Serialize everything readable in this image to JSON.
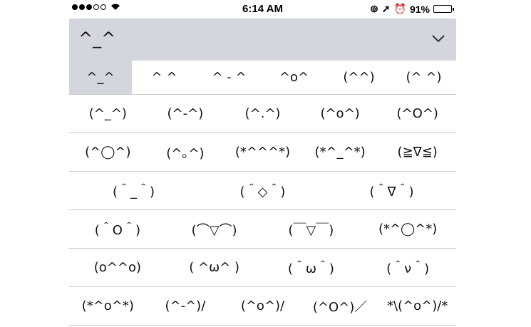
{
  "status_bar": {
    "time": "6:14 AM",
    "battery": "91%",
    "battery_level": 0.91,
    "signal_dots": [
      true,
      true,
      true,
      false,
      false
    ]
  },
  "header": {
    "title": "^_^"
  },
  "rows": [
    [
      "^_^",
      "^ ^",
      "^ - ^",
      "^o^",
      "(^^)",
      "(^ ^)"
    ],
    [
      "(^_^)",
      "(^-^)",
      "(^.^)",
      "(^o^)",
      "(^O^)"
    ],
    [
      "(^◯^)",
      "(^｡^)",
      "(*^^^*)",
      "(*^_^*)",
      "(≧∇≦)"
    ],
    [
      "(＾_＾)",
      "(＾◇＾)",
      "(＾∇＾)"
    ],
    [
      "(＾O＾)",
      "(⌒▽⌒)",
      "(￣▽￣)",
      "(*^◯^*)"
    ],
    [
      "(o^^o)",
      "( ^ω^ )",
      "(＾ω＾)",
      "(＾ν＾)"
    ],
    [
      "(*^o^*)",
      "(^-^)/",
      "(^o^)/",
      "(^O^)／",
      "*\\(^o^)/*"
    ]
  ]
}
